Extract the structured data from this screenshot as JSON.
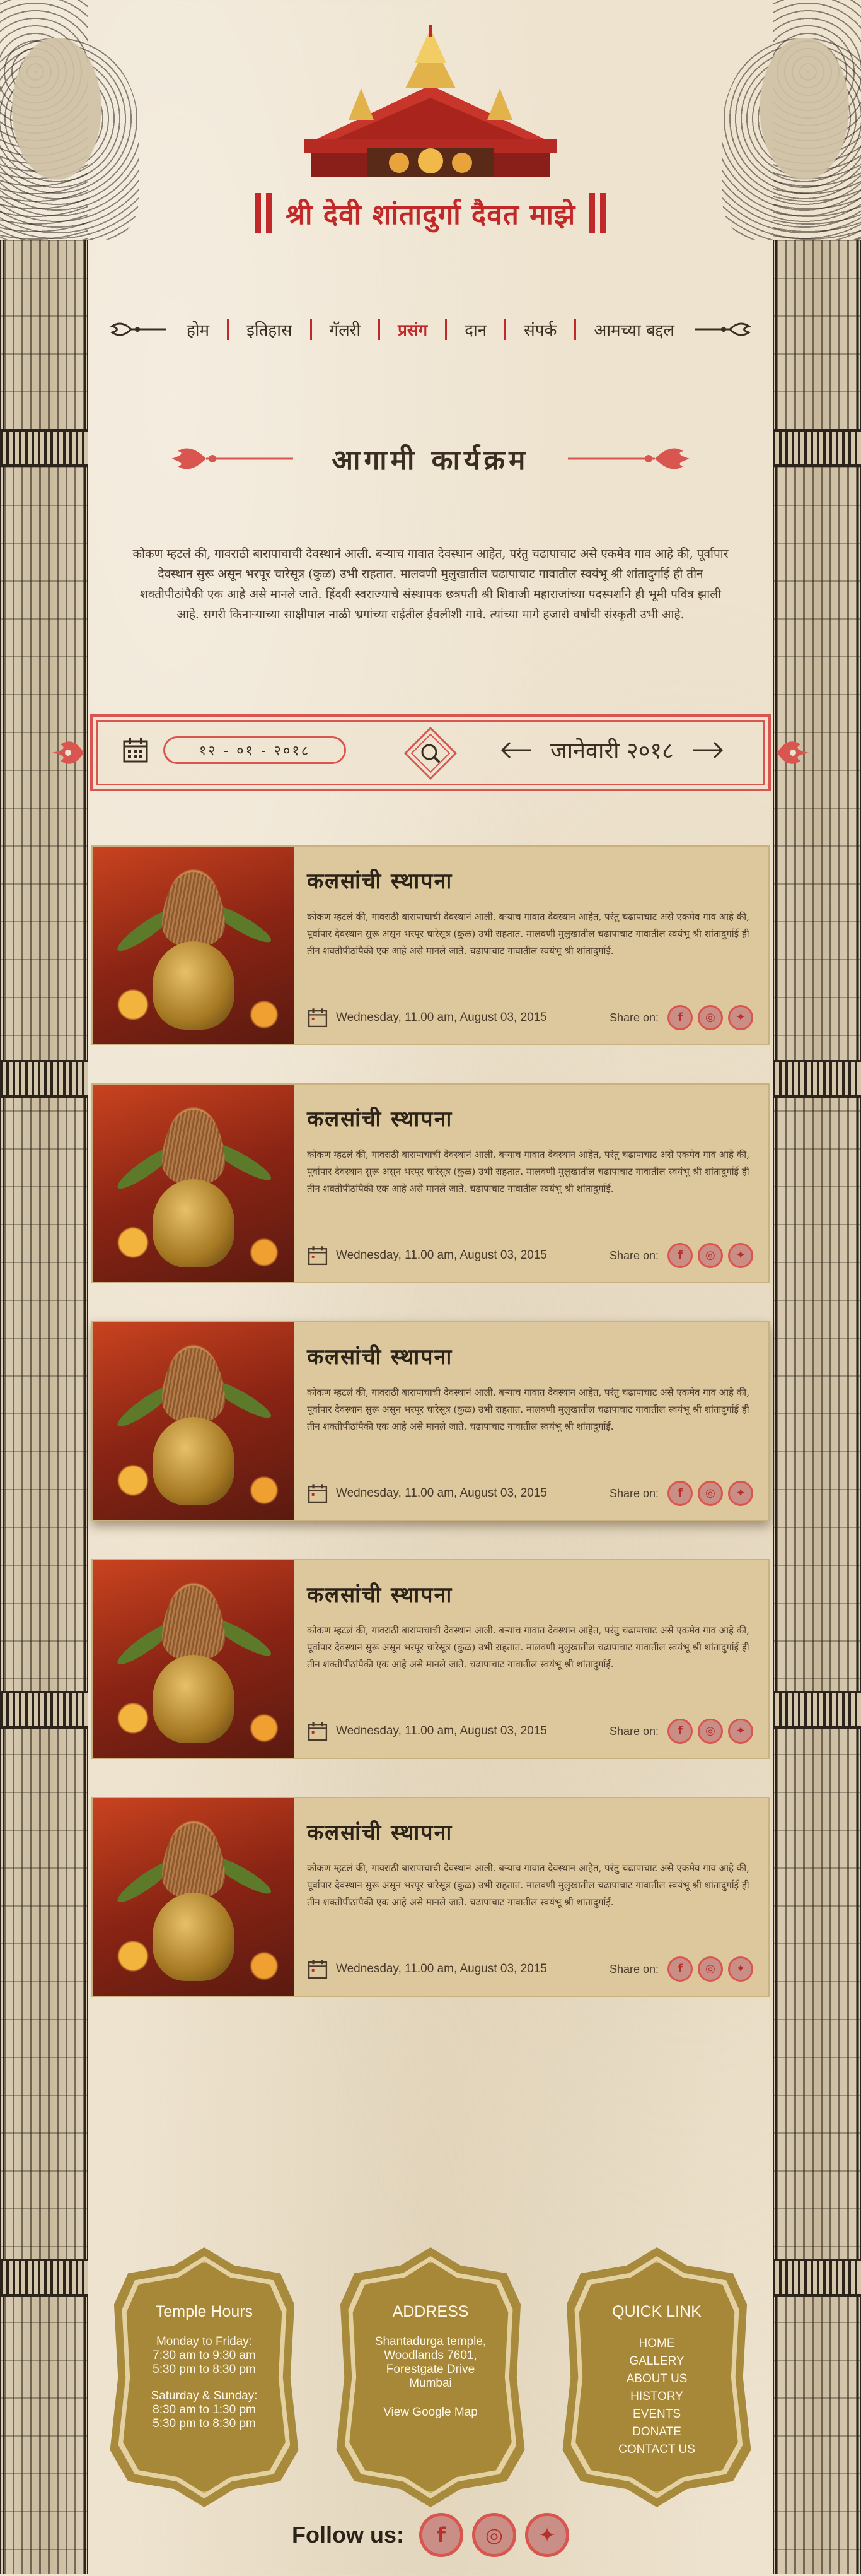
{
  "header": {
    "site_title": "श्री देवी शांतादुर्गा दैवत माझे"
  },
  "nav": {
    "items": [
      {
        "label": "होम",
        "active": false
      },
      {
        "label": "इतिहास",
        "active": false
      },
      {
        "label": "गॅलरी",
        "active": false
      },
      {
        "label": "प्रसंग",
        "active": true
      },
      {
        "label": "दान",
        "active": false
      },
      {
        "label": "संपर्क",
        "active": false
      },
      {
        "label": "आमच्या बद्दल",
        "active": false
      }
    ]
  },
  "section": {
    "title": "आगामी कार्यक्रम",
    "intro": "कोकण म्हटलं की, गावराठी बारापाचाची देवस्थानं आली. बऱ्याच गावात देवस्थान आहेत, परंतु चढापाचाट असे एकमेव गाव आहे की, पूर्वापार देवस्थान सुरू असून भरपूर चारेसूत्र (कुळ) उभी राहतात. मालवणी मुलुखातील चढापाचाट गावातील स्वयंभू श्री शांतादुर्गाई ही तीन शक्तीपीठांपैकी एक आहे असे मानले जाते. हिंदवी स्वराज्याचे संस्थापक छत्रपती श्री शिवाजी महाराजांच्या पदस्पर्शाने ही भूमी पवित्र झाली आहे. सगरी किनाऱ्याच्या साक्षीपाल नाळी भ्रगांच्या राईतील ईवलीशी गावे. त्यांच्या मागे हजारो वर्षांची संस्कृती उभी आहे."
  },
  "filter": {
    "date_value": "१२ - ०१ - २०१८",
    "month_label": "जानेवारी २०१८"
  },
  "events": [
    {
      "title": "कलसांची स्थापना",
      "description": "कोकण म्हटलं की, गावराठी बारापाचाची देवस्थानं आली. बऱ्याच गावात देवस्थान आहेत, परंतु चढापाचाट असे एकमेव गाव आहे की, पूर्वापार देवस्थान सुरू असून भरपूर चारेसूत्र (कुळ) उभी राहतात. मालवणी मुलुखातील चढापाचाट गावातील स्वयंभू श्री शांतादुर्गाई ही तीन शक्तीपीठांपैकी एक आहे असे मानले जाते. चढापाचाट गावातील स्वयंभू श्री शांतादुर्गाई.",
      "datetime": "Wednesday, 11.00 am, August 03, 2015",
      "share_label": "Share on:"
    },
    {
      "title": "कलसांची स्थापना",
      "description": "कोकण म्हटलं की, गावराठी बारापाचाची देवस्थानं आली. बऱ्याच गावात देवस्थान आहेत, परंतु चढापाचाट असे एकमेव गाव आहे की, पूर्वापार देवस्थान सुरू असून भरपूर चारेसूत्र (कुळ) उभी राहतात. मालवणी मुलुखातील चढापाचाट गावातील स्वयंभू श्री शांतादुर्गाई ही तीन शक्तीपीठांपैकी एक आहे असे मानले जाते. चढापाचाट गावातील स्वयंभू श्री शांतादुर्गाई.",
      "datetime": "Wednesday, 11.00 am, August 03, 2015",
      "share_label": "Share on:"
    },
    {
      "title": "कलसांची स्थापना",
      "description": "कोकण म्हटलं की, गावराठी बारापाचाची देवस्थानं आली. बऱ्याच गावात देवस्थान आहेत, परंतु चढापाचाट असे एकमेव गाव आहे की, पूर्वापार देवस्थान सुरू असून भरपूर चारेसूत्र (कुळ) उभी राहतात. मालवणी मुलुखातील चढापाचाट गावातील स्वयंभू श्री शांतादुर्गाई ही तीन शक्तीपीठांपैकी एक आहे असे मानले जाते. चढापाचाट गावातील स्वयंभू श्री शांतादुर्गाई.",
      "datetime": "Wednesday, 11.00 am, August 03, 2015",
      "share_label": "Share on:"
    },
    {
      "title": "कलसांची स्थापना",
      "description": "कोकण म्हटलं की, गावराठी बारापाचाची देवस्थानं आली. बऱ्याच गावात देवस्थान आहेत, परंतु चढापाचाट असे एकमेव गाव आहे की, पूर्वापार देवस्थान सुरू असून भरपूर चारेसूत्र (कुळ) उभी राहतात. मालवणी मुलुखातील चढापाचाट गावातील स्वयंभू श्री शांतादुर्गाई ही तीन शक्तीपीठांपैकी एक आहे असे मानले जाते. चढापाचाट गावातील स्वयंभू श्री शांतादुर्गाई.",
      "datetime": "Wednesday, 11.00 am, August 03, 2015",
      "share_label": "Share on:"
    },
    {
      "title": "कलसांची स्थापना",
      "description": "कोकण म्हटलं की, गावराठी बारापाचाची देवस्थानं आली. बऱ्याच गावात देवस्थान आहेत, परंतु चढापाचाट असे एकमेव गाव आहे की, पूर्वापार देवस्थान सुरू असून भरपूर चारेसूत्र (कुळ) उभी राहतात. मालवणी मुलुखातील चढापाचाट गावातील स्वयंभू श्री शांतादुर्गाई ही तीन शक्तीपीठांपैकी एक आहे असे मानले जाते. चढापाचाट गावातील स्वयंभू श्री शांतादुर्गाई.",
      "datetime": "Wednesday, 11.00 am, August 03, 2015",
      "share_label": "Share on:"
    }
  ],
  "footer": {
    "hours": {
      "heading": "Temple Hours",
      "weekday_label": "Monday to Friday:",
      "weekday_1": "7:30 am to 9:30 am",
      "weekday_2": "5:30 pm to 8:30 pm",
      "weekend_label": "Saturday & Sunday:",
      "weekend_1": "8:30 am to 1:30 pm",
      "weekend_2": "5:30 pm to 8:30 pm"
    },
    "address": {
      "heading": "ADDRESS",
      "line1": "Shantadurga temple,",
      "line2": "Woodlands 7601,",
      "line3": "Forestgate Drive",
      "line4": "Mumbai",
      "map_link": "View Google Map"
    },
    "quick": {
      "heading": "QUICK LINK",
      "links": [
        "HOME",
        "GALLERY",
        "ABOUT US",
        "HISTORY",
        "EVENTS",
        "DONATE",
        "CONTACT US"
      ]
    },
    "follow_label": "Follow us:"
  },
  "icons": {
    "calendar": "calendar-icon",
    "search": "search-icon",
    "prev": "arrow-left-icon",
    "next": "arrow-right-icon",
    "facebook": "facebook-icon",
    "instagram": "instagram-icon",
    "twitter": "twitter-icon"
  },
  "colors": {
    "accent_red": "#c0282a",
    "ornament_red": "#d95650",
    "card_bg": "#ddc89d",
    "footer_gold": "#a88a3d",
    "page_bg": "#eee3cf"
  }
}
